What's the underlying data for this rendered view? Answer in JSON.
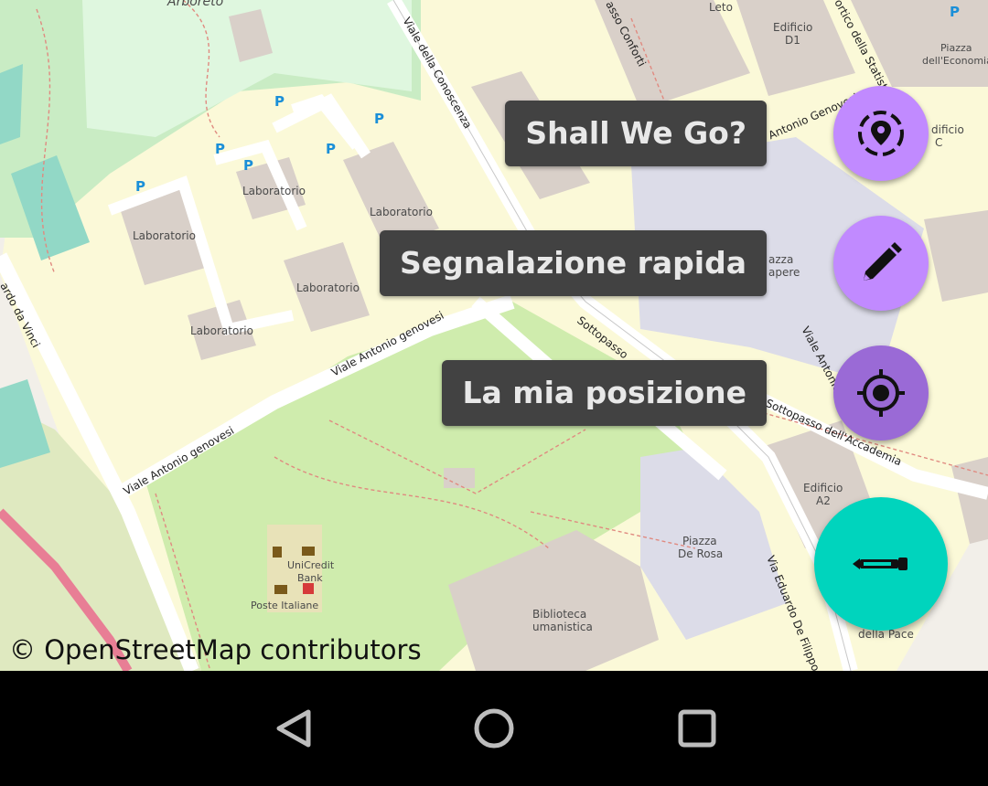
{
  "map": {
    "attribution": "© OpenStreetMap contributors",
    "labels": {
      "arboreto": "Arboreto",
      "laboratorio": "Laboratorio",
      "leto": "Leto",
      "edificio_d1_line1": "Edificio",
      "edificio_d1_line2": "D1",
      "edificio_c_line1": "dificio",
      "edificio_c_line2": "C",
      "piazza_economia_line1": "Piazza",
      "piazza_economia_line2": "dell'Economia",
      "piazza_sapere_line1": "azza",
      "piazza_sapere_line2": "apere",
      "edificio_a2_line1": "Edificio",
      "edificio_a2_line2": "A2",
      "piazza_derosa_line1": "Piazza",
      "piazza_derosa_line2": "De Rosa",
      "biblioteca_line1": "Biblioteca",
      "biblioteca_line2": "umanistica",
      "unicredit_line1": "UniCredit",
      "unicredit_line2": "Bank",
      "poste": "Poste Italiane",
      "della_pace": "della Pace",
      "parking": "P"
    },
    "roads": {
      "viale_conoscenza": "Viale della Conoscenza",
      "viale_genovesi_1": "Viale Antonio genovesi",
      "viale_genovesi_2": "Viale Antonio genovesi",
      "viale_antonio_genovesi_top": "Viale Antonio Genovesi",
      "sottopasso": "Sottopasso",
      "sottopasso_accademia": "Sottopasso dell'Accademia",
      "via_de_filippo": "Via Eduardo De Filippo",
      "leonardo_da_vinci": "ardo da Vinci",
      "viale_antonio_right": "Viale Antonio",
      "porta_conforti": "asso Conforti",
      "portico_statistica": "ortico della Statisti"
    }
  },
  "fab_menu": {
    "items": [
      {
        "label": "Shall We Go?",
        "icon": "location-target-icon",
        "color": "#c18aff"
      },
      {
        "label": "Segnalazione rapida",
        "icon": "pencil-icon",
        "color": "#c18aff"
      },
      {
        "label": "La mia posizione",
        "icon": "gps-crosshair-icon",
        "color": "#9a6ad6"
      }
    ],
    "main_button": {
      "icon": "marker-pen-icon",
      "color": "#00d4bd"
    }
  },
  "navbar": {
    "back": "back-triangle-icon",
    "home": "home-circle-icon",
    "recents": "recents-square-icon"
  }
}
